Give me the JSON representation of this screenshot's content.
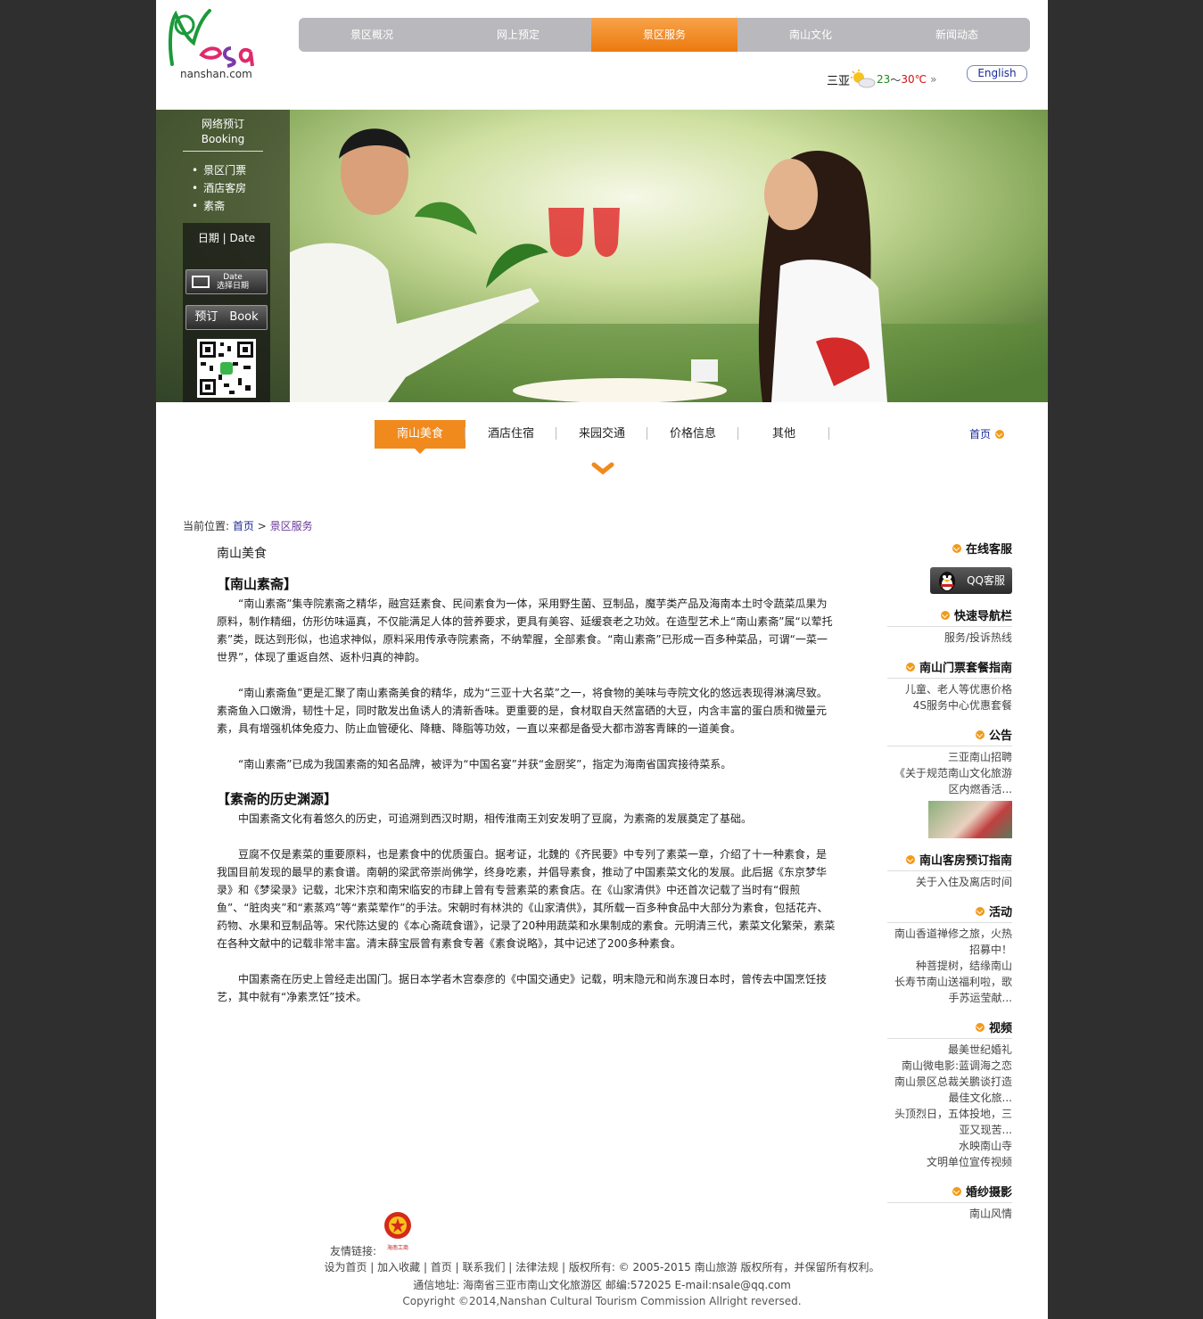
{
  "header": {
    "logo_text": "Nesa",
    "domain": "nanshan.com",
    "nav": [
      "景区概况",
      "网上预定",
      "景区服务",
      "南山文化",
      "新闻动态"
    ],
    "nav_active": 2,
    "weather": {
      "city": "三亚",
      "temp_low": "23",
      "separator": "～",
      "temp_high": "30℃",
      "more": "»"
    },
    "lang_button": "English"
  },
  "booking": {
    "title_cn": "网络预订",
    "title_en": "Booking",
    "items": [
      "景区门票",
      "酒店客房",
      "素斋"
    ],
    "date_label": "日期 | Date",
    "date_button_top": "Date",
    "date_button_bottom": "选择日期",
    "book_button": "预订　Book"
  },
  "subnav": {
    "items": [
      "南山美食",
      "酒店住宿",
      "来园交通",
      "价格信息",
      "其他"
    ],
    "active": 0,
    "home": "首页"
  },
  "breadcrumb": {
    "label": "当前位置:",
    "home": "首页",
    "sep": ">",
    "current": "景区服务"
  },
  "article": {
    "title": "南山美食",
    "h1": "【南山素斋】",
    "p1": "“南山素斋”集寺院素斋之精华，融宫廷素食、民间素食为一体，采用野生菌、豆制品，魔芋类产品及海南本土时令蔬菜瓜果为原料，制作精细，仿形仿味逼真，不仅能满足人体的营养要求，更具有美容、延缓衰老之功效。在造型艺术上“南山素斋”属“以荤托素”类，既达到形似，也追求神似，原料采用传承寺院素斋，不纳荤腥，全部素食。“南山素斋”已形成一百多种菜品，可谓“一菜一世界”，体现了重返自然、返朴归真的神韵。",
    "p2": "“南山素斋鱼”更是汇聚了南山素斋美食的精华，成为“三亚十大名菜”之一，将食物的美味与寺院文化的悠远表现得淋漓尽致。素斋鱼入口嫩滑，韧性十足，同时散发出鱼诱人的清新香味。更重要的是，食材取自天然富硒的大豆，内含丰富的蛋白质和微量元素，具有增强机体免疫力、防止血管硬化、降糖、降脂等功效，一直以来都是备受大都市游客青睐的一道美食。",
    "p3": "“南山素斋”已成为我国素斋的知名品牌，被评为“中国名宴”并获“金厨奖”，指定为海南省国宾接待菜系。",
    "h2": "【素斋的历史渊源】",
    "p4": "中国素斋文化有着悠久的历史，可追溯到西汉时期，相传淮南王刘安发明了豆腐，为素斋的发展奠定了基础。",
    "p5": "豆腐不仅是素菜的重要原料，也是素食中的优质蛋白。据考证，北魏的《齐民要》中专列了素菜一章，介绍了十一种素食，是我国目前发现的最早的素食谱。南朝的梁武帝崇尚佛学，终身吃素，并倡导素食，推动了中国素菜文化的发展。此后据《东京梦华录》和《梦梁录》记载，北宋汴京和南宋临安的市肆上曾有专营素菜的素食店。在《山家清供》中还首次记载了当时有“假煎鱼”、“脏肉夹”和“素蒸鸡”等“素菜荤作”的手法。宋朝时有林洪的《山家清供》，其所载一百多种食品中大部分为素食，包括花卉、药物、水果和豆制品等。宋代陈达叟的《本心斋疏食谱》，记录了20种用蔬菜和水果制成的素食。元明清三代，素菜文化繁荣，素菜在各种文献中的记载非常丰富。清末薛宝辰曾有素食专著《素食说略》，其中记述了200多种素食。",
    "p6": "中国素斋在历史上曾经走出国门。据日本学者木宫泰彦的《中国交通史》记载，明末隐元和尚东渡日本时，曾传去中国烹饪技艺，其中就有“净素烹饪”技术。"
  },
  "sidebar": {
    "online_service": "在线客服",
    "qq_button": "QQ客服",
    "quick_nav": "快速导航栏",
    "quick_nav_links": [
      "服务/投诉热线"
    ],
    "ticket_guide": "南山门票套餐指南",
    "ticket_links": [
      "儿童、老人等优惠价格",
      "4S服务中心优惠套餐"
    ],
    "notice": "公告",
    "notice_links": [
      "三亚南山招聘",
      "《关于规范南山文化旅游",
      "区内燃香活..."
    ],
    "room_guide": "南山客房预订指南",
    "room_links": [
      "关于入住及离店时间"
    ],
    "activity": "活动",
    "activity_links": [
      "南山香道禅修之旅，火热",
      "招募中！",
      "种菩提树，结缘南山",
      "长寿节南山送福利啦，歌",
      "手苏运莹献..."
    ],
    "video": "视频",
    "video_links": [
      "最美世纪婚礼",
      "南山微电影:蓝调海之恋",
      "南山景区总裁关鹏谈打造",
      "最佳文化旅...",
      "头顶烈日，五体投地，三",
      "亚又现苦...",
      "水映南山寺",
      "文明单位宣传视频"
    ],
    "wedding": "婚纱摄影",
    "wedding_links": [
      "南山风情"
    ]
  },
  "footer": {
    "badge_text": "海南工商",
    "links_label": "友情链接:",
    "line1": "设为首页 | 加入收藏 | 首页 | 联系我们 | 法律法规 | 版权所有: © 2005-2015 南山旅游 版权所有，并保留所有权利。",
    "line2": "通信地址: 海南省三亚市南山文化旅游区 邮编:572025 E-mail:nsale@qq.com",
    "line3": "Copyright ©2014,Nanshan Cultural Tourism Commission Allright reversed."
  },
  "colors": {
    "accent_orange": "#f08a1d",
    "nav_gray": "#b9b9bd",
    "link_blue": "#1a2a9a",
    "page_bg": "#2f2f2f"
  }
}
